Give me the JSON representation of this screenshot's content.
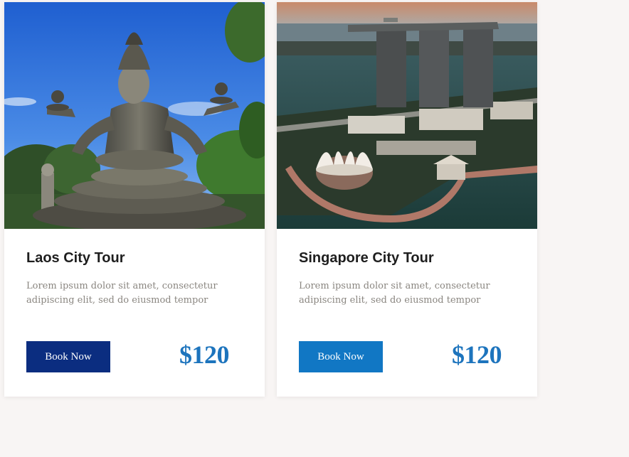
{
  "cards": [
    {
      "title": "Laos City Tour",
      "description": "Lorem ipsum dolor sit amet, consectetur adipiscing elit, sed do eiusmod tempor",
      "button_label": "Book Now",
      "price": "$120",
      "button_color": "#0b2d80"
    },
    {
      "title": "Singapore City Tour",
      "description": "Lorem ipsum dolor sit amet, consectetur adipiscing elit, sed do eiusmod tempor",
      "button_label": "Book Now",
      "price": "$120",
      "button_color": "#1177c4"
    }
  ],
  "colors": {
    "background": "#f8f5f4",
    "price": "#1d74bd",
    "title": "#1e1e1e",
    "description": "#8a8680"
  }
}
